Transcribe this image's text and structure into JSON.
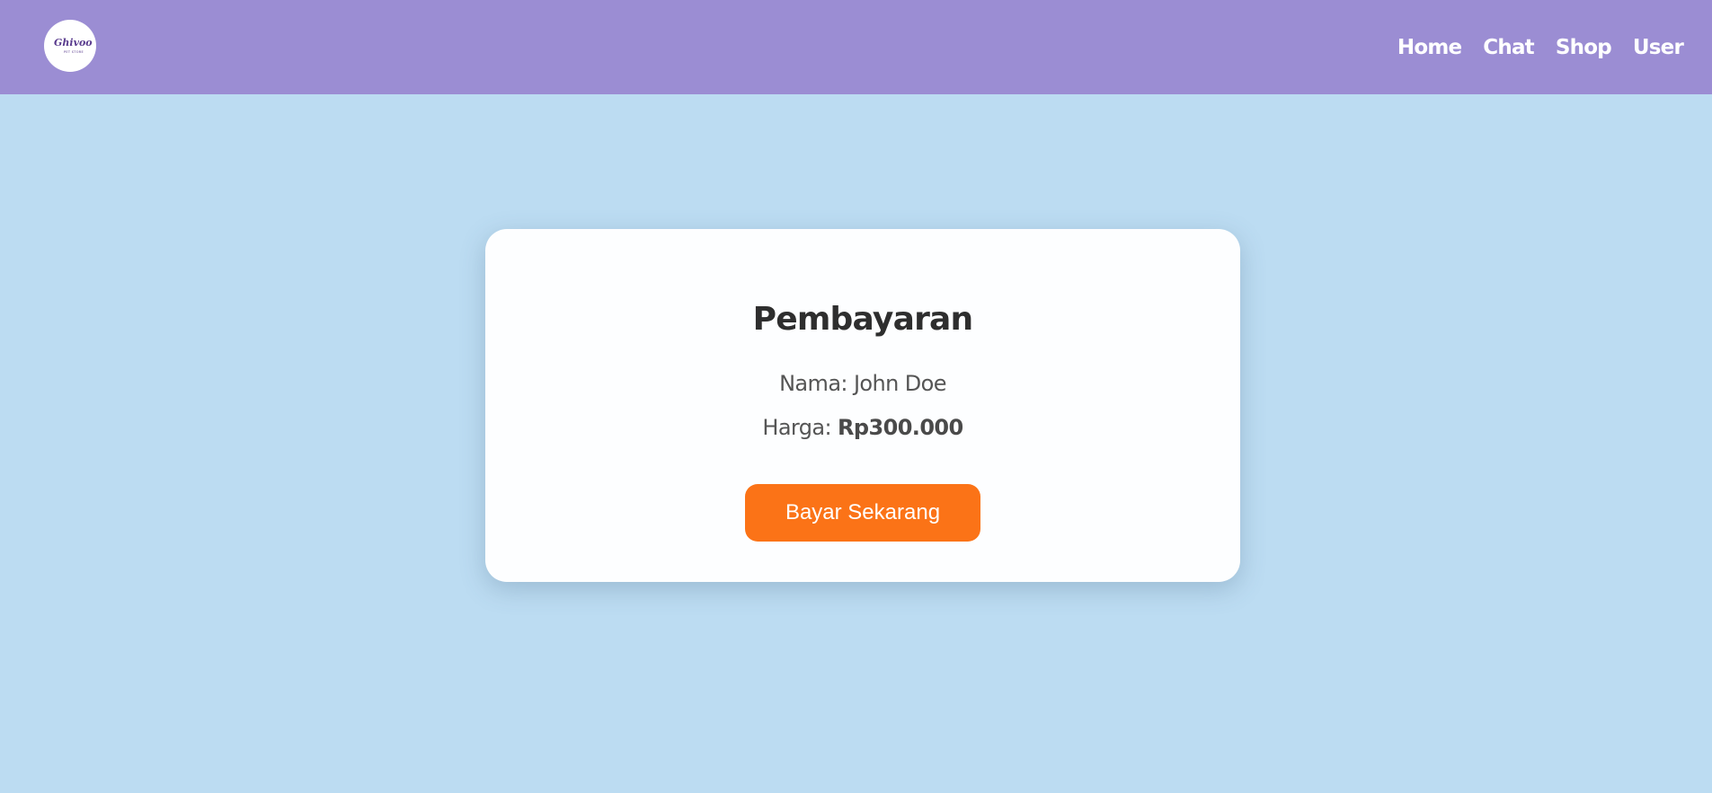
{
  "navbar": {
    "logo": {
      "brand": "Ghivoo",
      "tagline": "PET STORE",
      "accent_color": "#5a3c8e"
    },
    "links": [
      {
        "label": "Home"
      },
      {
        "label": "Chat"
      },
      {
        "label": "Shop"
      },
      {
        "label": "User"
      }
    ],
    "background_color": "#9b8dd3"
  },
  "payment": {
    "title": "Pembayaran",
    "name_label": "Nama:",
    "name_value": "John Doe",
    "price_label": "Harga:",
    "price_value": "Rp300.000",
    "button_label": "Bayar Sekarang",
    "button_color": "#fb7317"
  },
  "page": {
    "background_color": "#bcdcf2"
  }
}
